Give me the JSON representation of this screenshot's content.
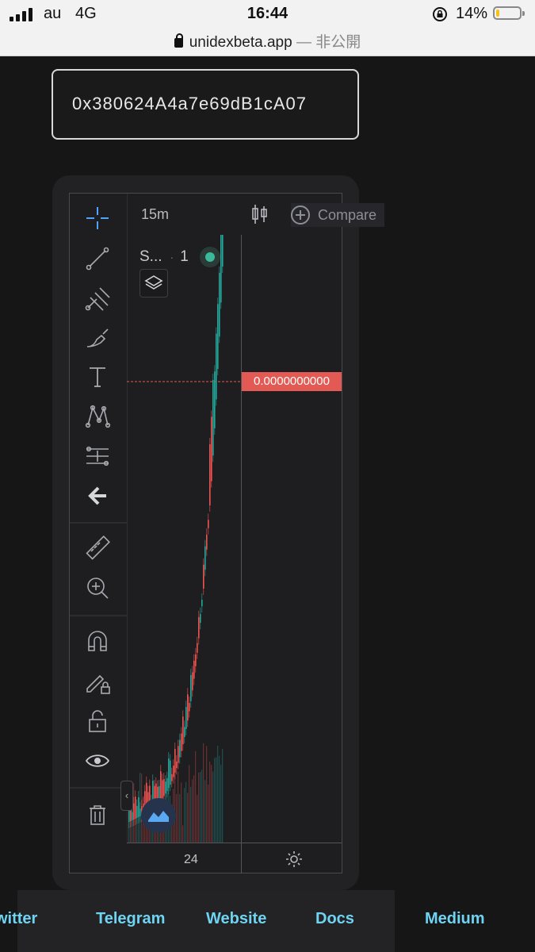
{
  "status_bar": {
    "carrier": "au",
    "network": "4G",
    "time": "16:44",
    "battery_percent": "14%",
    "battery_level": 0.14
  },
  "browser": {
    "url": "unidexbeta.app",
    "separator": "—",
    "privacy": "非公開"
  },
  "address_input": {
    "value": "0x380624A4a7e69dB1cA07"
  },
  "chart": {
    "timeframe": "15m",
    "compare_label": "Compare",
    "symbol": "S...",
    "legend_value": "1",
    "price_label": "0.0000000000",
    "x_tick": "24",
    "colors": {
      "up": "#26a69a",
      "down": "#ef5350",
      "price_tag": "#e35a55",
      "background": "#1e1e21"
    }
  },
  "left_tools": [
    "crosshair-icon",
    "trend-line-icon",
    "pitchfork-icon",
    "brush-icon",
    "text-icon",
    "pattern-icon",
    "measure-icon",
    "back-arrow-icon",
    "ruler-icon",
    "zoom-in-icon",
    "magnet-icon",
    "lock-drawing-icon",
    "unlock-icon",
    "eye-icon",
    "trash-icon"
  ],
  "footer": {
    "links": [
      "witter",
      "Telegram",
      "Website",
      "Docs",
      "Medium"
    ]
  }
}
